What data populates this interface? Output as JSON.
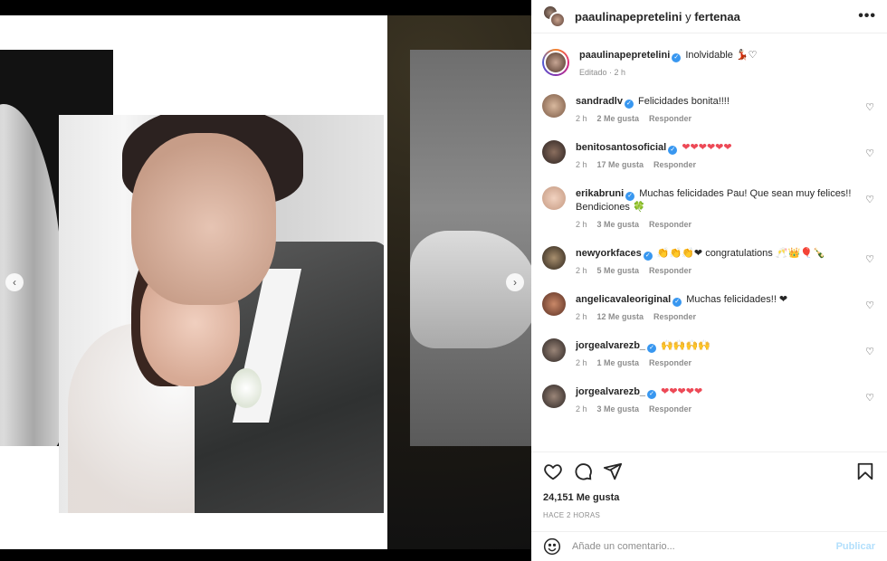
{
  "header": {
    "user1": "paaulinapepretelini",
    "connector": " y ",
    "user2": "fertenaa",
    "more": "•••"
  },
  "caption": {
    "user": "paaulinapepretelini",
    "text": "Inolvidable 💃🏻♡",
    "meta": "Editado · 2 h"
  },
  "comments": [
    {
      "user": "sandradlv",
      "verified": true,
      "text": "Felicidades bonita!!!!",
      "time": "2 h",
      "likes": "2 Me gusta",
      "reply": "Responder"
    },
    {
      "user": "benitosantosoficial",
      "verified": true,
      "text": "❤❤❤❤❤❤",
      "time": "2 h",
      "likes": "17 Me gusta",
      "reply": "Responder"
    },
    {
      "user": "erikabruni",
      "verified": true,
      "text": "Muchas felicidades Pau! Que sean muy felices!! Bendiciones 🍀",
      "time": "2 h",
      "likes": "3 Me gusta",
      "reply": "Responder"
    },
    {
      "user": "newyorkfaces",
      "verified": true,
      "text": "👏👏👏❤ congratulations 🥂👑🎈🍾",
      "time": "2 h",
      "likes": "5 Me gusta",
      "reply": "Responder"
    },
    {
      "user": "angelicavaleoriginal",
      "verified": true,
      "text": "Muchas felicidades!! ❤",
      "time": "2 h",
      "likes": "12 Me gusta",
      "reply": "Responder"
    },
    {
      "user": "jorgealvarezb_",
      "verified": true,
      "text": "🙌🙌🙌🙌",
      "time": "2 h",
      "likes": "1 Me gusta",
      "reply": "Responder"
    },
    {
      "user": "jorgealvarezb_",
      "verified": true,
      "text": "❤❤❤❤❤",
      "time": "2 h",
      "likes": "3 Me gusta",
      "reply": "Responder"
    }
  ],
  "likes": "24,151 Me gusta",
  "time_ago": "HACE 2 HORAS",
  "add_comment": {
    "placeholder": "Añade un comentario...",
    "publish": "Publicar"
  },
  "colors": {
    "verified": "#3897f0",
    "heart": "#ed4956",
    "publish_disabled": "#b2dffc"
  }
}
